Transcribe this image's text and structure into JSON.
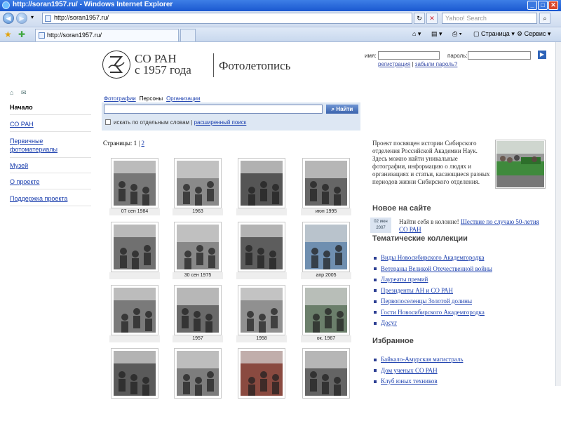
{
  "window": {
    "title": "http://soran1957.ru/ - Windows Internet Explorer",
    "buttons": {
      "minimize": "_",
      "maximize": "□",
      "close": "✕"
    }
  },
  "browser": {
    "address": "http://soran1957.ru/",
    "search_placeholder": "Yahoo! Search",
    "tab_title": "http://soran1957.ru/",
    "toolbar": {
      "page_label": "Страница",
      "tools_label": "Сервис"
    }
  },
  "site": {
    "brand_line1": "СО РАН",
    "brand_line2": "с 1957 года",
    "brand_section": "Фотолетопись"
  },
  "login": {
    "name_label": "имя:",
    "password_label": "пароль:",
    "register_link": "регистрация",
    "separator": "|",
    "forgot_link": "забыли пароль?"
  },
  "sidebar": {
    "items": [
      {
        "label": "Начало"
      },
      {
        "label": "СО РАН"
      },
      {
        "label": "Первичные фотоматериалы"
      },
      {
        "label": "Музей"
      },
      {
        "label": "О проекте"
      },
      {
        "label": "Поддержка проекта"
      }
    ]
  },
  "search": {
    "tabs": [
      "Фотографии",
      "Персоны",
      "Организации"
    ],
    "button_label": "Найти",
    "checkbox_label": "искать по отдельным словам",
    "divider": "|",
    "advanced_link": "расширенный поиск"
  },
  "pagination": {
    "label": "Страницы:",
    "page1": "1",
    "sep": "|",
    "page2": "2"
  },
  "thumbnails": [
    {
      "caption": "07 сен 1984"
    },
    {
      "caption": "1963"
    },
    {
      "caption": ""
    },
    {
      "caption": "июн 1995"
    },
    {
      "caption": ""
    },
    {
      "caption": "30 сен 1975"
    },
    {
      "caption": ""
    },
    {
      "caption": "апр 2005"
    },
    {
      "caption": ""
    },
    {
      "caption": "1957"
    },
    {
      "caption": "1958"
    },
    {
      "caption": "ок. 1967"
    },
    {
      "caption": ""
    },
    {
      "caption": ""
    },
    {
      "caption": ""
    },
    {
      "caption": ""
    }
  ],
  "about": {
    "text": "Проект посвящен истории Сибирского отделения Российской Академии Наук. Здесь можно найти уникальные фотографии, информацию о людях и организациях и статьи, касающиеся разных периодов жизни Сибирского отделения."
  },
  "news": {
    "heading": "Новое на сайте",
    "date_day": "02 июн",
    "date_year": "2007",
    "text": "Найти себя в колонне!",
    "link": "Шествие по случаю 50-летия СО РАН"
  },
  "collections": {
    "heading": "Тематические коллекции",
    "items": [
      "Виды Новосибирского Академгородка",
      "Ветераны Великой Отечественной войны",
      "Лауреаты премий",
      "Президенты АН и СО РАН",
      "Первопоселенцы Золотой долины",
      "Гости Новосибирского Академгородка",
      "Досуг"
    ]
  },
  "favorites": {
    "heading": "Избранное",
    "items": [
      "Байкало-Амурская магистраль",
      "Дом ученых СО РАН",
      "Клуб юных техников"
    ]
  },
  "colors": {
    "link": "#1b3fae",
    "panel": "#dde7f3",
    "titlebar": "#1b58d0"
  }
}
